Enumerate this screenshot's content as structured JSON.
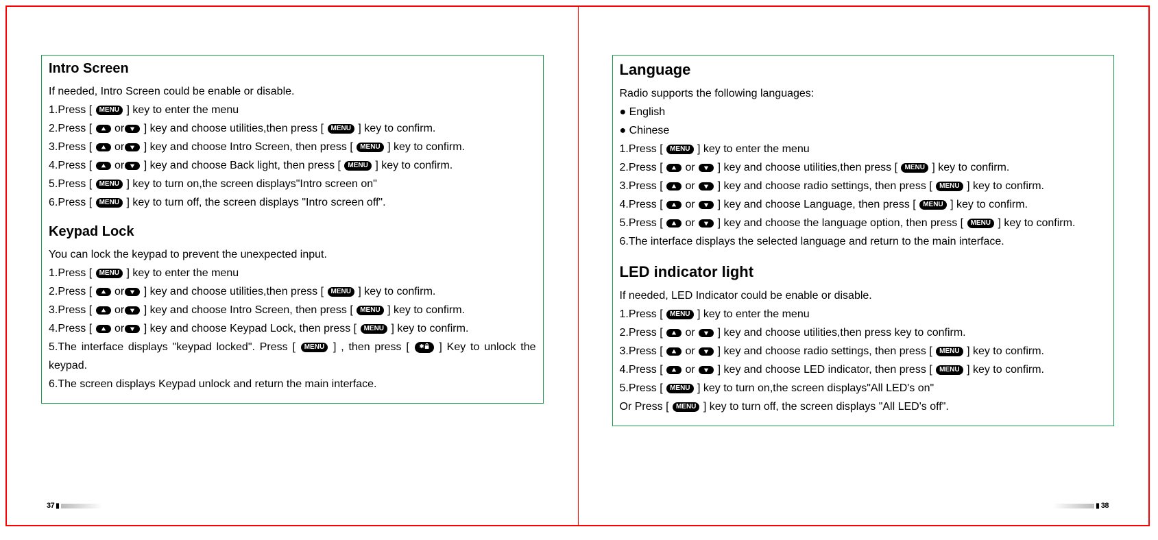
{
  "keys": {
    "menu": "MENU",
    "starlock": "✱🔒"
  },
  "left": {
    "pagenum": "37",
    "sections": [
      {
        "title": "Intro Screen",
        "intro": "If needed, Intro Screen could be enable or disable.",
        "steps": [
          {
            "pre": "1.Press [ ",
            "k": [
              "M"
            ],
            "post": " ] key to enter the menu"
          },
          {
            "pre": "2.Press [ ",
            "k": [
              "U",
              "D"
            ],
            "sep": " or",
            "post1": " ] key and choose utilities,then press [ ",
            "k2": [
              "M"
            ],
            "post2": " ] key to confirm."
          },
          {
            "pre": "3.Press [ ",
            "k": [
              "U",
              "D"
            ],
            "sep": " or",
            "post1": " ] key and choose Intro Screen, then press [ ",
            "k2": [
              "M"
            ],
            "post2": " ] key to confirm."
          },
          {
            "pre": "4.Press [ ",
            "k": [
              "U",
              "D"
            ],
            "sep": " or",
            "post1": " ] key and choose Back light, then press [ ",
            "k2": [
              "M"
            ],
            "post2": " ] key to confirm."
          },
          {
            "pre": "5.Press [ ",
            "k": [
              "M"
            ],
            "post": " ] key to turn on,the screen displays\"Intro screen on\""
          },
          {
            "pre": "6.Press [ ",
            "k": [
              "M"
            ],
            "post": " ] key to turn off, the screen displays \"Intro screen off\"."
          }
        ]
      },
      {
        "title": "Keypad Lock",
        "intro": "You can lock the keypad to prevent the unexpected input.",
        "steps": [
          {
            "pre": "1.Press [ ",
            "k": [
              "M"
            ],
            "post": " ] key to enter the menu"
          },
          {
            "pre": "2.Press [ ",
            "k": [
              "U",
              "D"
            ],
            "sep": " or",
            "post1": " ] key and choose utilities,then press [ ",
            "k2": [
              "M"
            ],
            "post2": " ] key to confirm."
          },
          {
            "pre": "3.Press [ ",
            "k": [
              "U",
              "D"
            ],
            "sep": " or",
            "post1": " ] key and choose Intro Screen, then press [ ",
            "k2": [
              "M"
            ],
            "post2": " ] key to confirm."
          },
          {
            "pre": "4.Press [ ",
            "k": [
              "U",
              "D"
            ],
            "sep": " or",
            "post1": " ] key and choose Keypad Lock, then press [ ",
            "k2": [
              "M"
            ],
            "post2": " ] key to confirm."
          },
          {
            "pre": "5.The interface displays \"keypad locked\". Press [ ",
            "k": [
              "M"
            ],
            "post1": " ] , then press [  ",
            "k2": [
              "L"
            ],
            "post2": " ] Key to unlock the keypad.",
            "justify": true
          },
          {
            "pre": "6.The screen displays Keypad unlock and return the main interface."
          }
        ]
      }
    ]
  },
  "right": {
    "pagenum": "38",
    "sections": [
      {
        "title": "Language",
        "big": true,
        "intro": "Radio supports the following languages:",
        "bullets": [
          "English",
          "Chinese"
        ],
        "steps": [
          {
            "pre": "1.Press [ ",
            "k": [
              "M"
            ],
            "post": " ] key to enter the menu"
          },
          {
            "pre": "2.Press [ ",
            "k": [
              "U",
              "D"
            ],
            "sep": " or ",
            "post1": " ] key and choose utilities,then press [ ",
            "k2": [
              "M"
            ],
            "post2": " ] key to confirm."
          },
          {
            "pre": "3.Press [ ",
            "k": [
              "U",
              "D"
            ],
            "sep": " or ",
            "post1": " ] key and choose radio settings, then press [ ",
            "k2": [
              "M"
            ],
            "post2": " ] key to confirm."
          },
          {
            "pre": "4.Press [ ",
            "k": [
              "U",
              "D"
            ],
            "sep": " or ",
            "post1": " ] key and choose Language, then press [ ",
            "k2": [
              "M"
            ],
            "post2": " ] key to confirm."
          },
          {
            "pre": "5.Press [ ",
            "k": [
              "U",
              "D"
            ],
            "sep": " or ",
            "post1": " ] key and choose the language option, then press [ ",
            "k2": [
              "M"
            ],
            "post2": " ] key to confirm.",
            "justify": true
          },
          {
            "pre": "6.The interface displays the selected language and return to the main interface."
          }
        ]
      },
      {
        "title": "LED indicator light",
        "big": true,
        "intro": "If needed, LED Indicator could be enable or disable.",
        "steps": [
          {
            "pre": "1.Press [ ",
            "k": [
              "M"
            ],
            "post": " ] key to enter the menu"
          },
          {
            "pre": "2.Press [ ",
            "k": [
              "U",
              "D"
            ],
            "sep": " or ",
            "post1": " ] key and choose utilities,then press  key to confirm."
          },
          {
            "pre": "3.Press [ ",
            "k": [
              "U",
              "D"
            ],
            "sep": " or ",
            "post1": " ] key and choose radio settings, then press [ ",
            "k2": [
              "M"
            ],
            "post2": " ] key to confirm."
          },
          {
            "pre": "4.Press [ ",
            "k": [
              "U",
              "D"
            ],
            "sep": " or ",
            "post1": " ] key and choose LED indicator, then press [ ",
            "k2": [
              "M"
            ],
            "post2": " ] key to confirm."
          },
          {
            "pre": "5.Press [ ",
            "k": [
              "M"
            ],
            "post": " ] key to turn on,the screen displays\"All LED's on\""
          },
          {
            "pre": " Or Press [ ",
            "k": [
              "M"
            ],
            "post": " ] key to turn off, the screen displays \"All LED's off\"."
          }
        ]
      }
    ]
  }
}
